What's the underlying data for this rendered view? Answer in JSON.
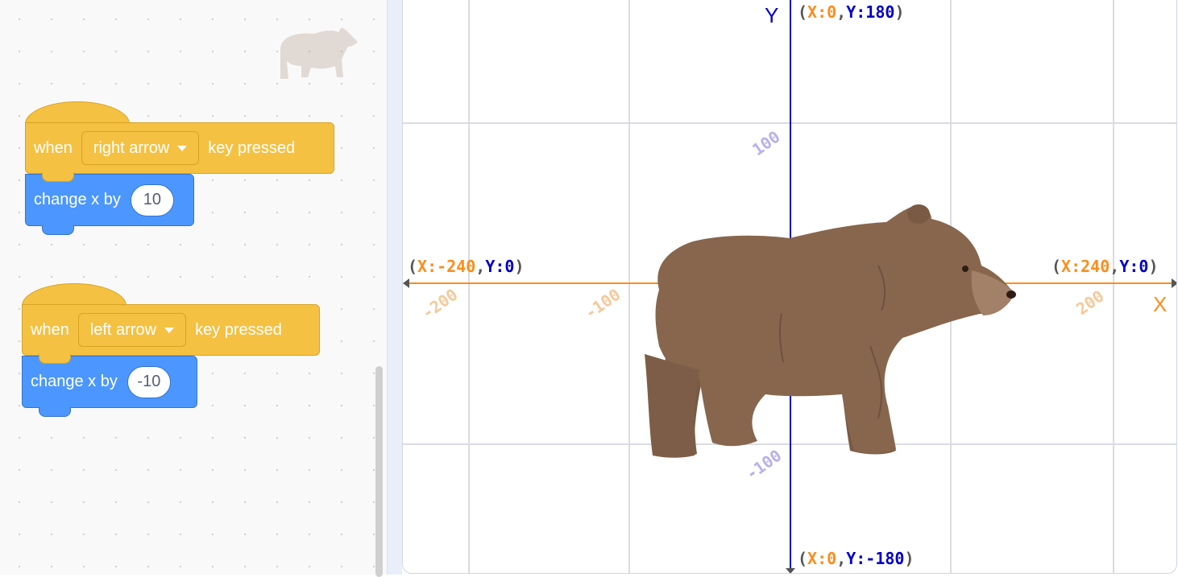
{
  "scripts": [
    {
      "hat": {
        "when": "when",
        "key": "right arrow",
        "suffix": "key pressed"
      },
      "motion": {
        "label": "change x by",
        "value": "10"
      }
    },
    {
      "hat": {
        "when": "when",
        "key": "left arrow",
        "suffix": "key pressed"
      },
      "motion": {
        "label": "change x by",
        "value": "-10"
      }
    }
  ],
  "stage": {
    "axis_labels": {
      "x": "X",
      "y": "Y"
    },
    "corner_coords": {
      "top": {
        "open": "(",
        "x": "X:0",
        "sep": ",",
        "y": "Y:180",
        "close": ")"
      },
      "bottom": {
        "open": "(",
        "x": "X:0",
        "sep": ",",
        "y": "Y:-180",
        "close": ")"
      },
      "left": {
        "open": "(",
        "x": "X:-240",
        "sep": ",",
        "y": "Y:0",
        "close": ")"
      },
      "right": {
        "open": "(",
        "x": "X:240",
        "sep": ",",
        "y": "Y:0",
        "close": ")"
      }
    },
    "x_ticks": [
      "-200",
      "-100",
      "200"
    ],
    "y_ticks": [
      "100",
      "-100"
    ],
    "sprite": "bear"
  },
  "colors": {
    "x_axis": "#ff8c1a",
    "y_axis": "#0000c8",
    "event_block": "#f5c142",
    "motion_block": "#4c97ff",
    "grid": "#d9dce3"
  }
}
